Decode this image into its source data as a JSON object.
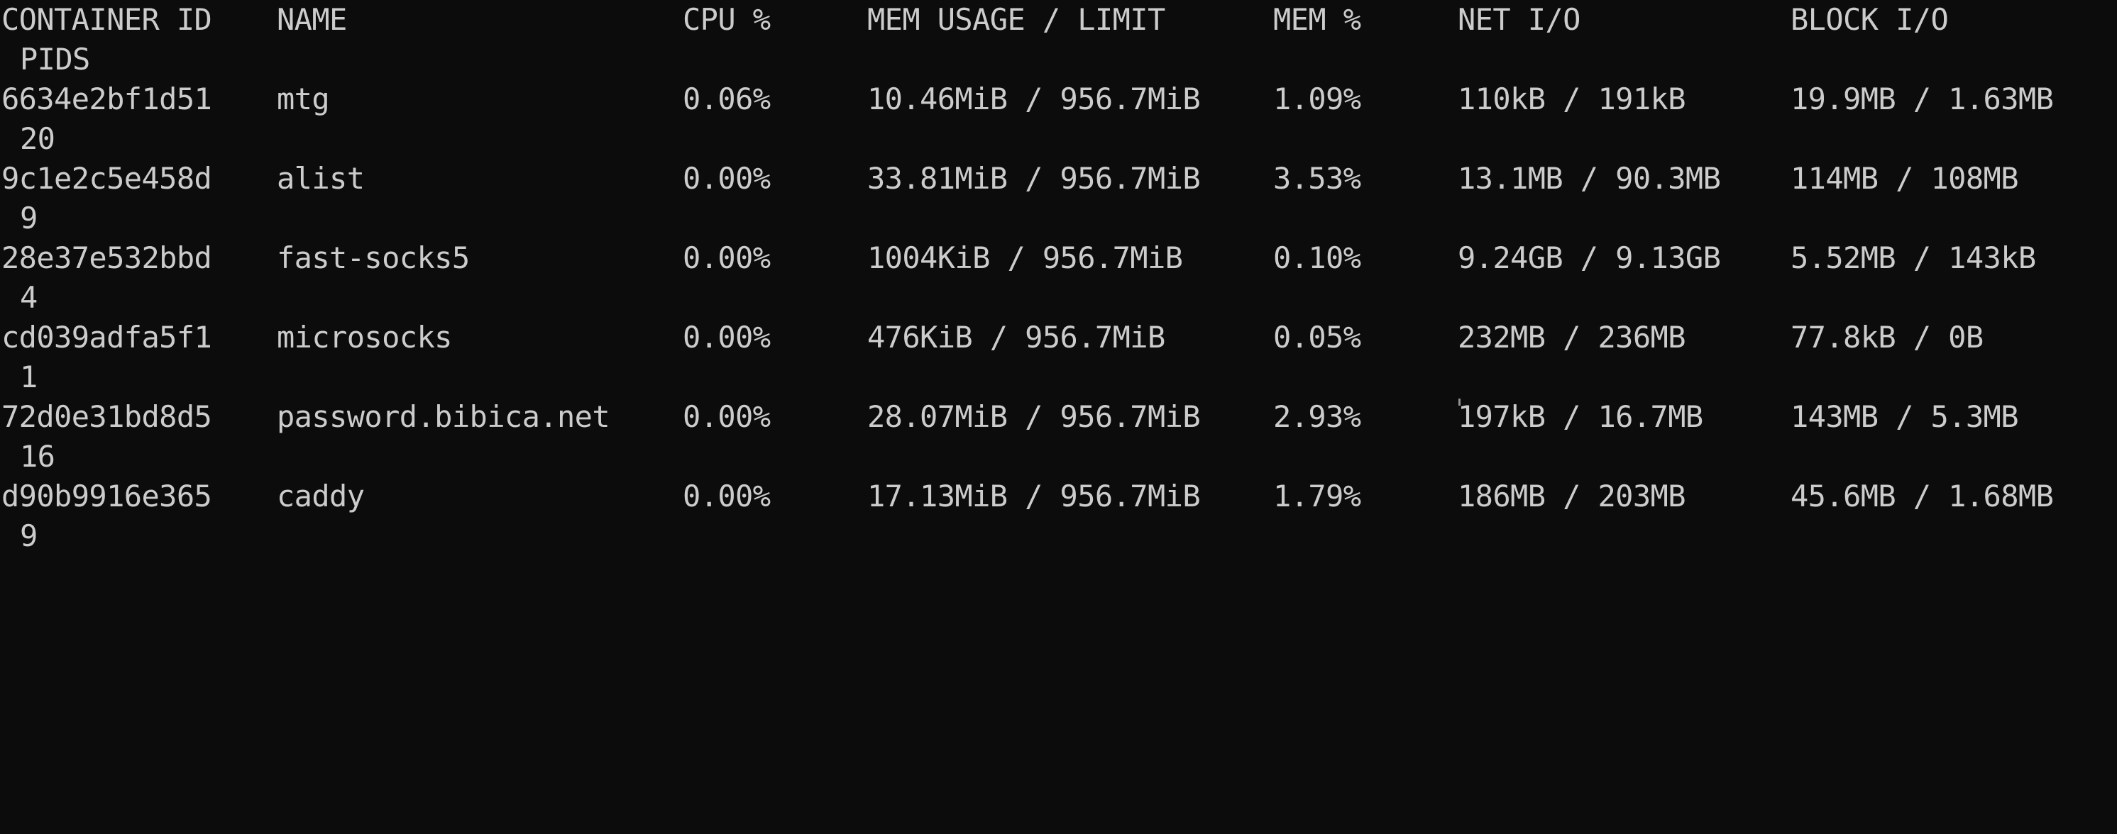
{
  "headers": {
    "container_id": "CONTAINER ID",
    "name": "NAME",
    "cpu": "CPU %",
    "mem_usage": "MEM USAGE / LIMIT",
    "mem_pct": "MEM %",
    "net_io": "NET I/O",
    "block_io": "BLOCK I/O",
    "pids": "PIDS"
  },
  "rows": [
    {
      "id": "6634e2bf1d51",
      "name": "mtg",
      "cpu": "0.06%",
      "mem": "10.46MiB / 956.7MiB",
      "memp": "1.09%",
      "net": "110kB / 191kB",
      "block": "19.9MB / 1.63MB",
      "pids": "20"
    },
    {
      "id": "9c1e2c5e458d",
      "name": "alist",
      "cpu": "0.00%",
      "mem": "33.81MiB / 956.7MiB",
      "memp": "3.53%",
      "net": "13.1MB / 90.3MB",
      "block": "114MB / 108MB",
      "pids": "9"
    },
    {
      "id": "28e37e532bbd",
      "name": "fast-socks5",
      "cpu": "0.00%",
      "mem": "1004KiB / 956.7MiB",
      "memp": "0.10%",
      "net": "9.24GB / 9.13GB",
      "block": "5.52MB / 143kB",
      "pids": "4"
    },
    {
      "id": "cd039adfa5f1",
      "name": "microsocks",
      "cpu": "0.00%",
      "mem": "476KiB / 956.7MiB",
      "memp": "0.05%",
      "net": "232MB / 236MB",
      "block": "77.8kB / 0B",
      "pids": "1"
    },
    {
      "id": "72d0e31bd8d5",
      "name": "password.bibica.net",
      "cpu": "0.00%",
      "mem": "28.07MiB / 956.7MiB",
      "memp": "2.93%",
      "net": "197kB / 16.7MB",
      "block": "143MB / 5.3MB",
      "pids": "16"
    },
    {
      "id": "d90b9916e365",
      "name": "caddy",
      "cpu": "0.00%",
      "mem": "17.13MiB / 956.7MiB",
      "memp": "1.79%",
      "net": "186MB / 203MB",
      "block": "45.6MB / 1.68MB",
      "pids": "9"
    }
  ]
}
